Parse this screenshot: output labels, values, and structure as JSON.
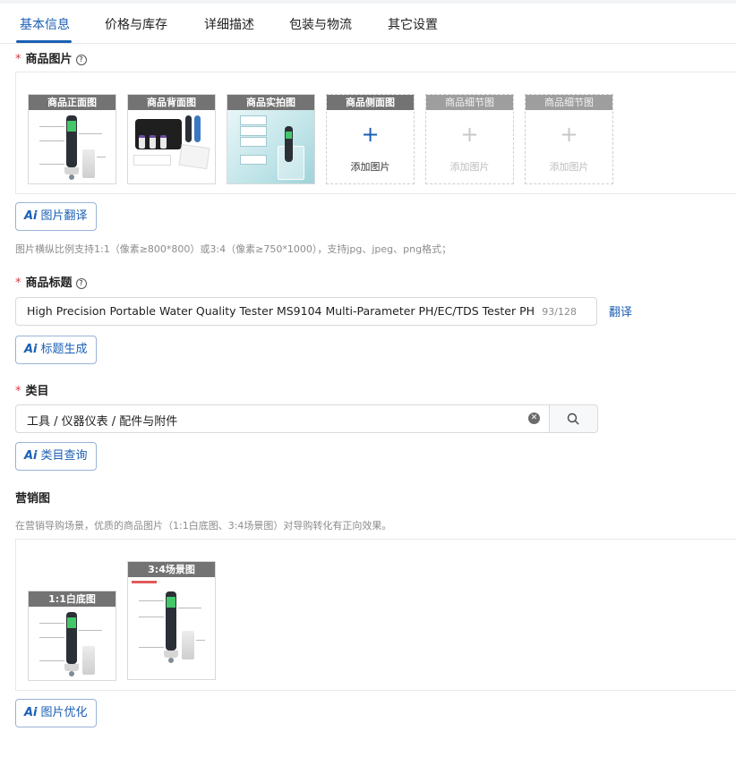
{
  "tabs": [
    {
      "label": "基本信息",
      "active": true
    },
    {
      "label": "价格与库存"
    },
    {
      "label": "详细描述"
    },
    {
      "label": "包装与物流"
    },
    {
      "label": "其它设置"
    }
  ],
  "product_images": {
    "required_mark": "*",
    "title": "商品图片",
    "help_icon": "question-circle-icon",
    "slots": [
      {
        "label": "商品正面图",
        "state": "filled"
      },
      {
        "label": "商品背面图",
        "state": "filled"
      },
      {
        "label": "商品实拍图",
        "state": "filled"
      },
      {
        "label": "商品侧面图",
        "state": "empty",
        "add_text": "添加图片"
      },
      {
        "label": "商品细节图",
        "state": "disabled",
        "add_text": "添加图片"
      },
      {
        "label": "商品细节图",
        "state": "disabled",
        "add_text": "添加图片"
      }
    ],
    "ai_button": {
      "ai": "Ai",
      "label": "图片翻译"
    },
    "hint": "图片横纵比例支持1:1（像素≥800*800）或3:4（像素≥750*1000），支持jpg、jpeg、png格式；"
  },
  "product_title": {
    "required_mark": "*",
    "title": "商品标题",
    "value": "High Precision Portable Water Quality Tester MS9104 Multi-Parameter PH/EC/TDS Tester PH",
    "counter": "93/128",
    "translate": "翻译",
    "ai_button": {
      "ai": "Ai",
      "label": "标题生成"
    }
  },
  "category": {
    "required_mark": "*",
    "title": "类目",
    "value": "工具 / 仪器仪表 / 配件与附件",
    "clear_icon": "clear-circle-icon",
    "search_icon": "search-icon",
    "ai_button": {
      "ai": "Ai",
      "label": "类目查询"
    }
  },
  "marketing": {
    "title": "营销图",
    "hint": "在营销导购场景，优质的商品图片（1:1白底图、3:4场景图）对导购转化有正向效果。",
    "images": [
      {
        "label": "1:1白底图"
      },
      {
        "label": "3:4场景图"
      }
    ],
    "ai_button": {
      "ai": "Ai",
      "label": "图片优化"
    }
  },
  "colors": {
    "accent": "#1a5fb4",
    "required": "#d9363e",
    "hint": "#8c8c8c"
  }
}
